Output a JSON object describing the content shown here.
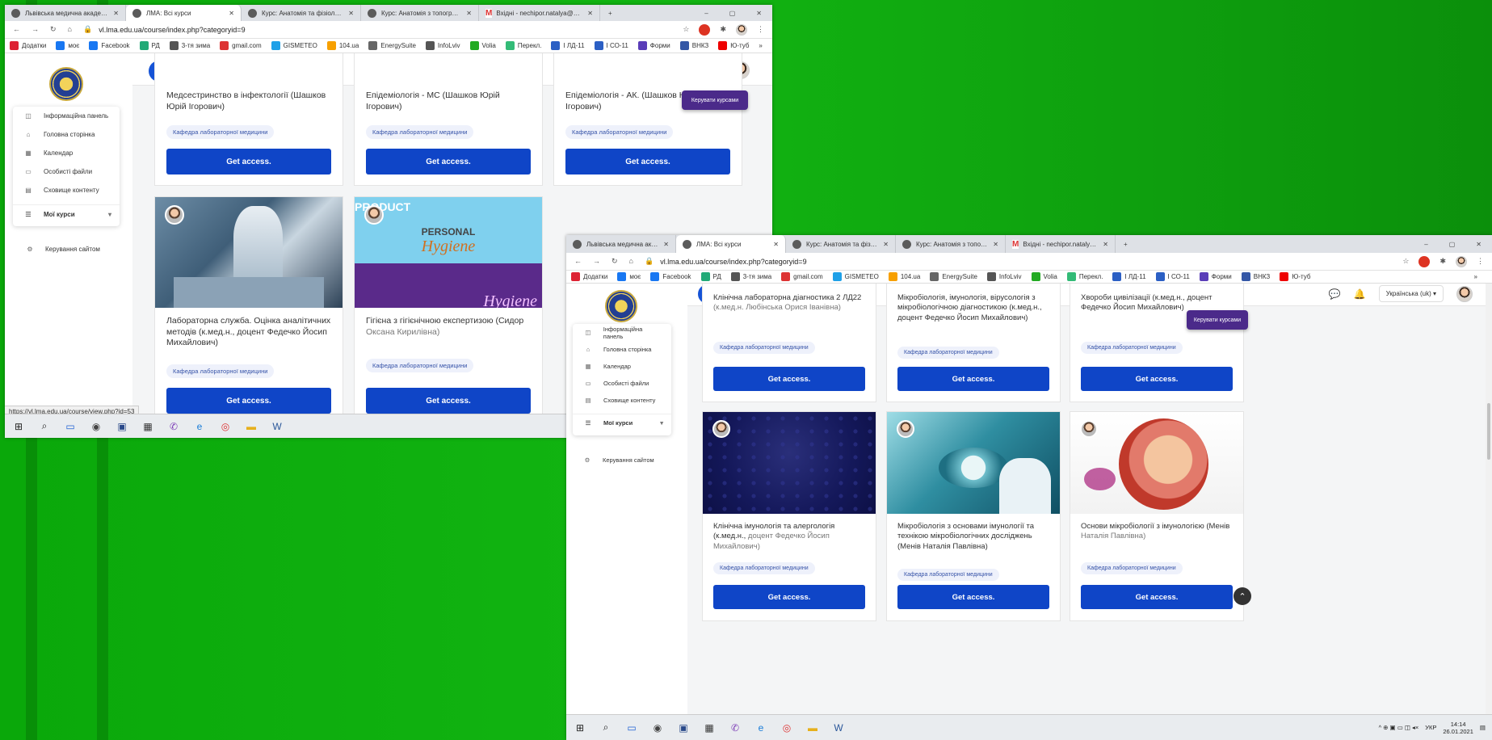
{
  "browser": {
    "tabs": [
      {
        "title": "Львівська медична академія ім",
        "active": false,
        "icon": "site-icon"
      },
      {
        "title": "ЛМА: Всі курси",
        "active": true,
        "icon": "site-icon"
      },
      {
        "title": "Курс: Анатомія та фізіологія (Н",
        "active": false,
        "icon": "site-icon"
      },
      {
        "title": "Курс: Анатомія з топографічн",
        "active": false,
        "icon": "site-icon"
      },
      {
        "title": "Вхідні - nechipor.natalya@gmai",
        "active": false,
        "icon": "gmail-icon"
      }
    ],
    "new_tab": "+",
    "url": "vl.lma.edu.ua/course/index.php?categoryid=9",
    "bookmarks": [
      "Додатки",
      "моє",
      "Facebook",
      "РД",
      "3-тя зима",
      "gmail.com",
      "GISMETEO",
      "104.ua",
      "EnergySuite",
      "InfoLviv",
      "Volia",
      "Перекл.",
      "І ЛД-11",
      "І СО-11",
      "Форми",
      "ВНКЗ",
      "Ю-туб"
    ],
    "bookmark_colors": [
      "#d23",
      "#1877f2",
      "#1877f2",
      "#2a7",
      "#555",
      "#d33",
      "#1ea0e8",
      "#f7a000",
      "#666",
      "#555",
      "#2a2",
      "#3b7",
      "#2b5fc4",
      "#2b5fc4",
      "#5a3db8",
      "#3457a6",
      "#e00"
    ]
  },
  "colors": {
    "accent": "#0f45c7",
    "manage": "#4b2a8a",
    "tag_bg": "#eef1fb"
  },
  "page": {
    "nav": {
      "language": "Українська (uk)",
      "chat_icon": "chat-icon",
      "bell_icon": "bell-icon"
    },
    "sidebar": {
      "items": [
        {
          "label": "Інформаційна панель",
          "icon": "dashboard-icon",
          "glyph": "◫"
        },
        {
          "label": "Головна сторінка",
          "icon": "home-icon",
          "glyph": "⌂"
        },
        {
          "label": "Календар",
          "icon": "calendar-icon",
          "glyph": "▦"
        },
        {
          "label": "Особисті файли",
          "icon": "files-icon",
          "glyph": "▭"
        },
        {
          "label": "Сховище контенту",
          "icon": "content-bank-icon",
          "glyph": "▤"
        },
        {
          "label": "Мої курси",
          "icon": "courses-icon",
          "glyph": "☰"
        }
      ],
      "site_admin": "Керування сайтом"
    },
    "manage_courses": "Керувати курсами",
    "tag": "Кафедра лабораторної медицини",
    "get_access": "Get access."
  },
  "shot1": {
    "cards_top": [
      {
        "title": "Медсестринство в інфектології (Шашков Юрій Ігорович)",
        "sub": ""
      },
      {
        "title": "Епідеміологія - МС (Шашков Юрій Ігорович)",
        "sub": ""
      },
      {
        "title": "Епідеміологія - АК. (Шашков Юрій Ігорович)",
        "sub": ""
      }
    ],
    "cards_bottom": [
      {
        "title": "Лабораторна служба. Оцінка аналітичних методів (к.мед.н., доцент Федечко Йосип Михайлович)",
        "sub": "",
        "image": "hospital-photo"
      },
      {
        "title": "Гігієна з гігієнічною експертизою (Сидор ",
        "sub": "Оксана Кирилівна)",
        "image": "hygiene-photo",
        "image_text": [
          "PRODUCT",
          "PERSONAL",
          "Hygiene",
          "Hygiene"
        ]
      }
    ],
    "status_url": "https://vl.lma.edu.ua/course/view.php?id=53"
  },
  "shot2": {
    "cards_top": [
      {
        "title": "Клінічна лабораторна діагностика 2 ЛД22 ",
        "sub": "(к.мед.н. Любінська Орися Іванівна)"
      },
      {
        "title": "Мікробіологія, імунологія, вірусологія з мікробіологічною діагностикою (к.мед.н., доцент Федечко Йосип Михайлович)",
        "sub": ""
      },
      {
        "title": "Хвороби цивілізації (к.мед.н., доцент Федечко Йосип Михайлович)",
        "sub": ""
      }
    ],
    "cards_bottom": [
      {
        "title": "Клінічна імунологія та алергологія (к.мед.н., ",
        "sub": "доцент Федечко Йосип Михайлович)",
        "image": "hex-pattern"
      },
      {
        "title": "Мікробіологія з основами імунології та технікою мікробіологічних досліджень (Менів Наталія Павлівна)",
        "sub": "",
        "image": "lab-photo"
      },
      {
        "title": "Основи мікробіології з імунологією (Менів ",
        "sub": "Наталія Павлівна)",
        "image": "embryo-illustration"
      }
    ],
    "tray": {
      "lang": "УКР",
      "time": "14:14",
      "date": "26.01.2021"
    }
  },
  "taskbar_icons": [
    "windows-start-icon",
    "search-icon",
    "cortana-icon",
    "camera-icon",
    "save-icon",
    "calculator-icon",
    "viber-icon",
    "edge-icon",
    "chrome-icon",
    "explorer-icon",
    "word-icon"
  ]
}
